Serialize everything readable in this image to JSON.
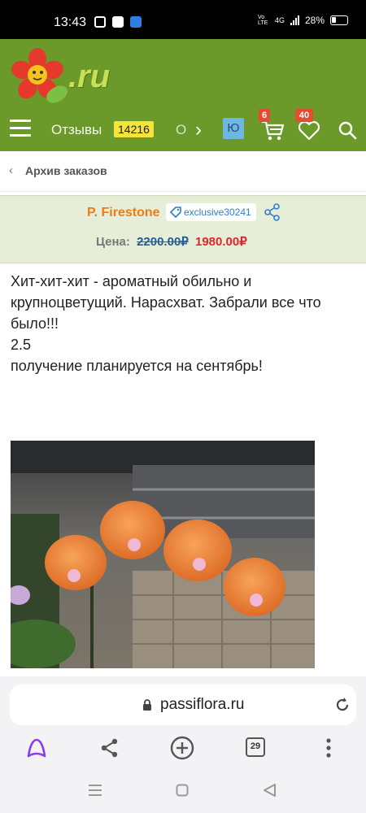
{
  "status_bar": {
    "time": "13:43",
    "network": "4G",
    "volte": "Vo LTE",
    "battery": "28%"
  },
  "header": {
    "logo_text": ".ru",
    "nav_reviews_label": "Отзывы",
    "nav_reviews_count": "14216",
    "nav_next_label": "О",
    "user_initial": "Ю",
    "cart_count": "6",
    "favorites_count": "40"
  },
  "breadcrumb": {
    "label": "Архив заказов"
  },
  "product": {
    "name": "P. Firestone",
    "code": "exclusive30241",
    "price_label": "Цена:",
    "old_price": "2200.00₽",
    "new_price": "1980.00₽"
  },
  "description": {
    "line1": "Хит-хит-хит - ароматный обильно и крупноцветущий. Нарасхват. Забрали все что было!!!",
    "line2": "2.5",
    "line3": "получение планируется на сентябрь!"
  },
  "browser": {
    "url": "passiflora.ru",
    "tab_count": "29"
  },
  "colors": {
    "header_bg": "#6b9a2a",
    "accent_orange": "#ef7b12",
    "price_red": "#e0242a",
    "link_blue": "#2b7fd2",
    "badge_red": "#e84c2e",
    "count_yellow": "#f5e43a"
  }
}
